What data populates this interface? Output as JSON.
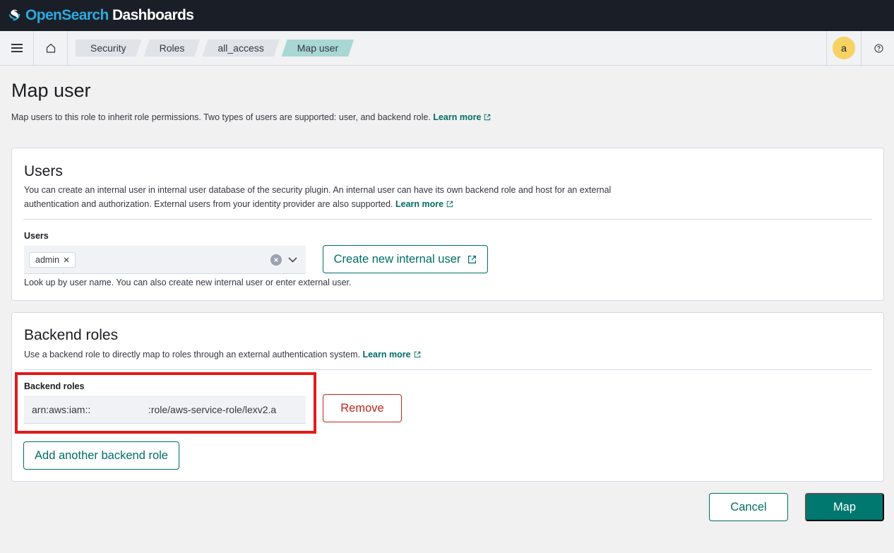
{
  "header": {
    "brand_part1": "OpenSearch",
    "brand_part2": " Dashboards"
  },
  "navbar": {
    "breadcrumbs": [
      "Security",
      "Roles",
      "all_access",
      "Map user"
    ],
    "avatar_initial": "a"
  },
  "page": {
    "title": "Map user",
    "description": "Map users to this role to inherit role permissions. Two types of users are supported: user, and backend role.",
    "learn_more": "Learn more"
  },
  "users_panel": {
    "title": "Users",
    "description": "You can create an internal user in internal user database of the security plugin. An internal user can have its own backend role and host for an external authentication and authorization. External users from your identity provider are also supported.",
    "learn_more": "Learn more",
    "field_label": "Users",
    "selected_users": [
      "admin"
    ],
    "create_button": "Create new internal user",
    "help_text": "Look up by user name. You can also create new internal user or enter external user."
  },
  "roles_panel": {
    "title": "Backend roles",
    "description": "Use a backend role to directly map to roles through an external authentication system.",
    "learn_more": "Learn more",
    "field_label": "Backend roles",
    "role_value": "arn:aws:iam::                     :role/aws-service-role/lexv2.a",
    "remove_button": "Remove",
    "add_button": "Add another backend role"
  },
  "footer": {
    "cancel_button": "Cancel",
    "map_button": "Map"
  },
  "colors": {
    "accent": "#006d66",
    "primary_button": "#00786f",
    "danger": "#bd271e",
    "highlight_box": "#e11b1b",
    "current_crumb": "#a9d7d3"
  },
  "icons": [
    "opensearch-logo-icon",
    "hamburger-menu-icon",
    "home-icon",
    "help-icon",
    "external-link-icon",
    "clear-icon",
    "chevron-down-icon",
    "close-icon"
  ]
}
